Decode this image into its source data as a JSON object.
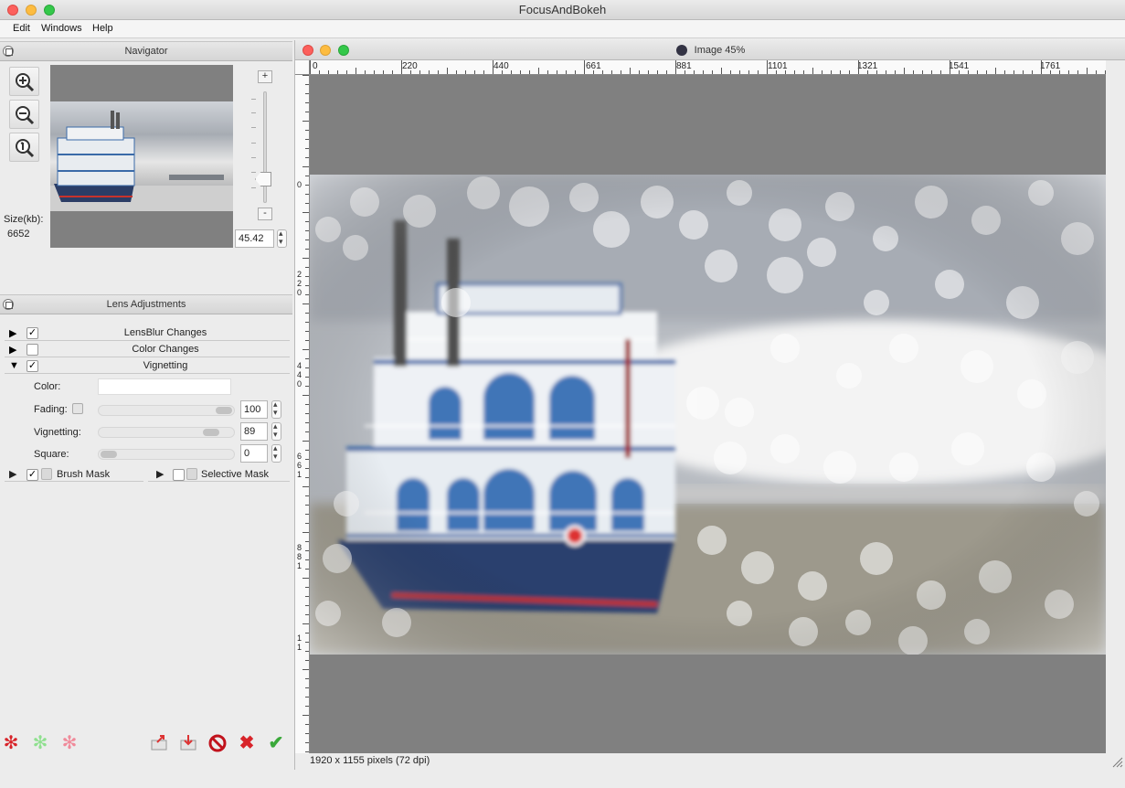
{
  "app": {
    "title": "FocusAndBokeh"
  },
  "menu": {
    "items": [
      "Edit",
      "Windows",
      "Help"
    ]
  },
  "navigator": {
    "title": "Navigator",
    "size_label": "Size(kb):",
    "size_value": "6652",
    "zoom_in_plus": "+",
    "zoom_out_minus": "-",
    "zoom_value": "45.42",
    "zoom_level_pct": 45
  },
  "lens": {
    "title": "Lens Adjustments",
    "sections": [
      {
        "label": "LensBlur Changes",
        "checked": true,
        "expanded": false
      },
      {
        "label": "Color Changes",
        "checked": false,
        "expanded": false
      },
      {
        "label": "Vignetting",
        "checked": true,
        "expanded": true
      }
    ],
    "color_label": "Color:",
    "fading_label": "Fading:",
    "fading_value": "100",
    "vignetting_label": "Vignetting:",
    "vignetting_value": "89",
    "square_label": "Square:",
    "square_value": "0",
    "brush_mask_label": "Brush Mask",
    "brush_mask_checked": true,
    "selective_mask_label": "Selective Mask",
    "selective_mask_checked": false
  },
  "document": {
    "title": "Image 45%",
    "ruler_h": [
      "0",
      "220",
      "440",
      "661",
      "881",
      "1101",
      "1321",
      "1541",
      "1761"
    ],
    "ruler_v": [
      "0",
      "2\n2\n0",
      "4\n4\n0",
      "6\n6\n1",
      "8\n8\n1",
      "1\n1"
    ],
    "status": "1920 x 1155 pixels (72 dpi)"
  },
  "colors": {
    "red_accent": "#d8242a",
    "green_accent": "#3aa93a"
  }
}
